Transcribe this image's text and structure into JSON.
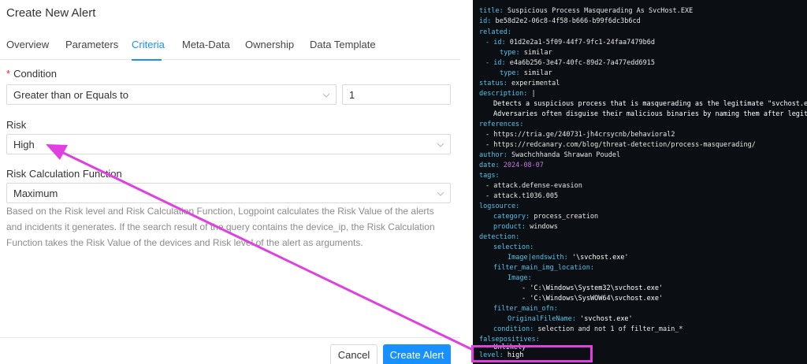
{
  "dialog": {
    "title": "Create New Alert",
    "tabs": [
      {
        "label": "Overview"
      },
      {
        "label": "Parameters"
      },
      {
        "label": "Criteria"
      },
      {
        "label": "Meta-Data"
      },
      {
        "label": "Ownership"
      },
      {
        "label": "Data Template"
      }
    ],
    "active_tab": "Criteria",
    "condition": {
      "label": "Condition",
      "required_mark": "*",
      "operator": "Greater than or Equals to",
      "value": "1"
    },
    "risk": {
      "label": "Risk",
      "value": "High"
    },
    "risk_calc": {
      "label": "Risk Calculation Function",
      "value": "Maximum",
      "help": "Based on the Risk level and Risk Calculation Function, Logpoint calculates the Risk Value of the alerts and incidents it generates. If the search result of the query contains the device_ip, the Risk Calculation Function takes the Risk Value of the devices and Risk level of the alert as arguments."
    },
    "buttons": {
      "cancel": "Cancel",
      "create": "Create Alert"
    }
  },
  "yaml": {
    "lines": [
      {
        "k": "title",
        "v": "Suspicious Process Masquerading As SvcHost.EXE"
      },
      {
        "k": "id",
        "v": "be58d2e2-06c8-4f58-b666-b99f6dc3b6cd"
      },
      {
        "k": "related",
        "v": ""
      },
      {
        "k": "- id",
        "v": "01d2e2a1-5f09-44f7-9fc1-24faa7479b6d"
      },
      {
        "k": "type",
        "v": "similar"
      },
      {
        "k": "- id",
        "v": "e4a6b256-3e47-40fc-89d2-7a477edd6915"
      },
      {
        "k": "type",
        "v": "similar"
      },
      {
        "k": "status",
        "v": "experimental"
      },
      {
        "k": "description",
        "v": "|"
      },
      {
        "k": "",
        "v": "Detects a suspicious process that is masquerading as the legitimate \"svchost.exe\" by nami"
      },
      {
        "k": "",
        "v": "Adversaries often disguise their malicious binaries by naming them after legitimate syste"
      },
      {
        "k": "references",
        "v": ""
      },
      {
        "k": "",
        "v": "- https://tria.ge/240731-jh4crsycnb/behavioral2"
      },
      {
        "k": "",
        "v": "- https://redcanary.com/blog/threat-detection/process-masquerading/"
      },
      {
        "k": "author",
        "v": "Swachchhanda Shrawan Poudel"
      },
      {
        "k": "date",
        "v": "2024-08-07"
      },
      {
        "k": "tags",
        "v": ""
      },
      {
        "k": "",
        "v": "- attack.defense-evasion"
      },
      {
        "k": "",
        "v": "- attack.t1036.005"
      },
      {
        "k": "logsource",
        "v": ""
      },
      {
        "k": "category",
        "v": "process_creation"
      },
      {
        "k": "product",
        "v": "windows"
      },
      {
        "k": "detection",
        "v": ""
      },
      {
        "k": "selection",
        "v": ""
      },
      {
        "k": "Image|endswith",
        "v": "'\\svchost.exe'"
      },
      {
        "k": "filter_main_img_location",
        "v": ""
      },
      {
        "k": "Image",
        "v": ""
      },
      {
        "k": "",
        "v": "- 'C:\\Windows\\System32\\svchost.exe'"
      },
      {
        "k": "",
        "v": "- 'C:\\Windows\\SysWOW64\\svchost.exe'"
      },
      {
        "k": "filter_main_ofn",
        "v": ""
      },
      {
        "k": "OriginalFileName",
        "v": "'svchost.exe'"
      },
      {
        "k": "condition",
        "v": "selection and not 1 of filter_main_*"
      },
      {
        "k": "falsepositives",
        "v": ""
      },
      {
        "k": "",
        "v": "- Unlikely"
      },
      {
        "k": "level",
        "v": "high"
      }
    ]
  },
  "colors": {
    "accent": "#1890ff",
    "yaml_key": "#53c3e8",
    "yaml_date": "#c678dd",
    "annotation": "#e040e0",
    "code_bg": "#0b0f14"
  }
}
